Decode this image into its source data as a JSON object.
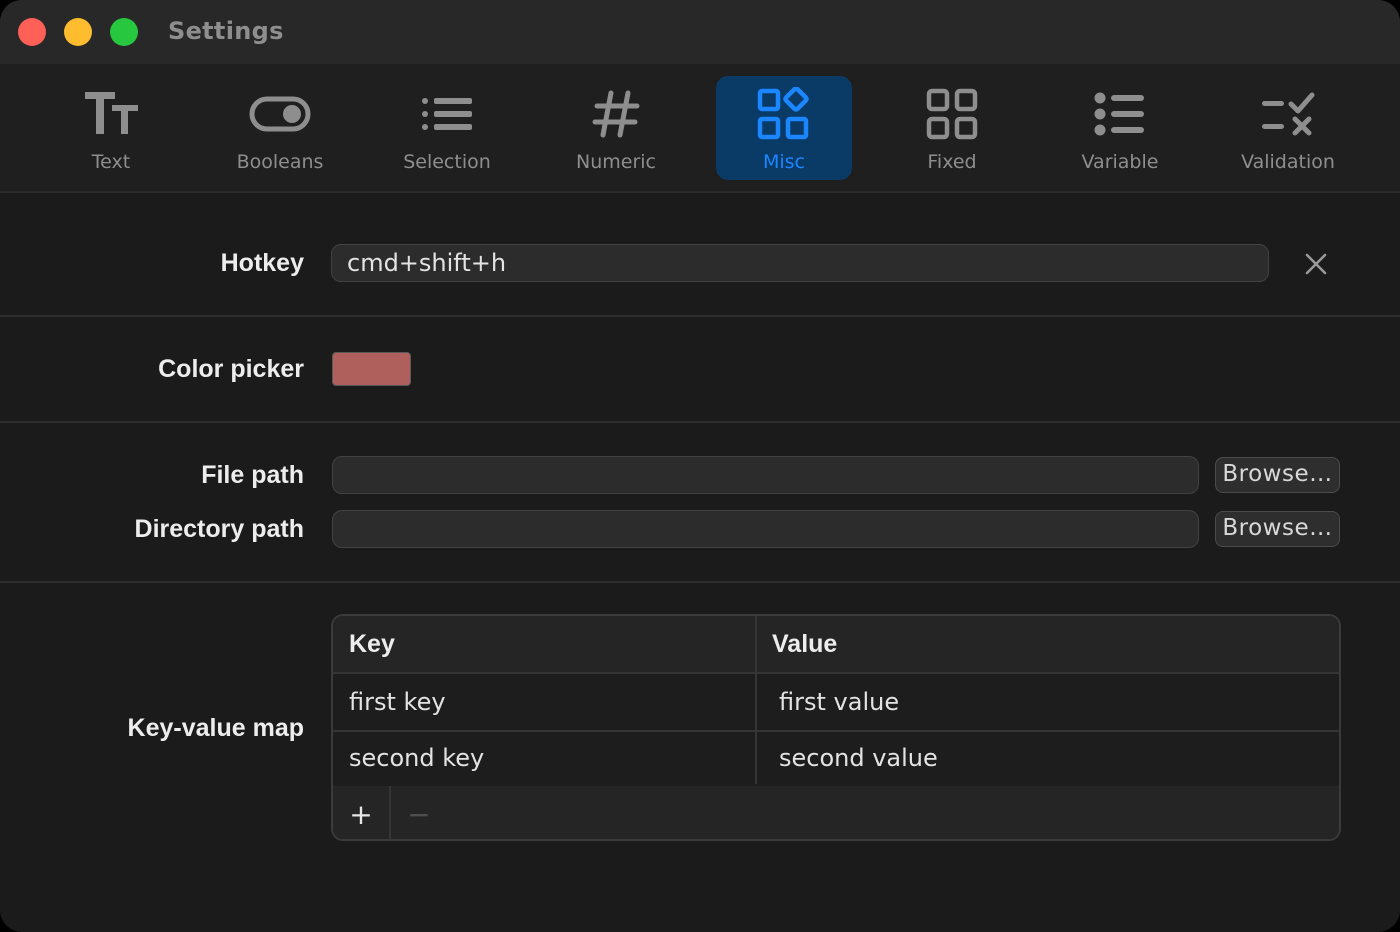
{
  "window": {
    "title": "Settings"
  },
  "toolbar": {
    "tabs": [
      {
        "label": "Text",
        "icon": "text-format-icon",
        "active": false
      },
      {
        "label": "Booleans",
        "icon": "toggle-icon",
        "active": false
      },
      {
        "label": "Selection",
        "icon": "list-icon",
        "active": false
      },
      {
        "label": "Numeric",
        "icon": "number-sign-icon",
        "active": false
      },
      {
        "label": "Misc",
        "icon": "apps-grid-icon",
        "active": true
      },
      {
        "label": "Fixed",
        "icon": "grid-icon",
        "active": false
      },
      {
        "label": "Variable",
        "icon": "bullet-list-icon",
        "active": false
      },
      {
        "label": "Validation",
        "icon": "checklist-icon",
        "active": false
      }
    ]
  },
  "hotkey": {
    "label": "Hotkey",
    "value": "cmd+shift+h"
  },
  "color_picker": {
    "label": "Color picker",
    "color": "#b0605c"
  },
  "file_path": {
    "label": "File path",
    "value": "",
    "browse_label": "Browse…"
  },
  "directory_path": {
    "label": "Directory path",
    "value": "",
    "browse_label": "Browse…"
  },
  "key_value_map": {
    "label": "Key-value map",
    "columns": [
      "Key",
      "Value"
    ],
    "rows": [
      {
        "key": "first key",
        "value": "first value"
      },
      {
        "key": "second key",
        "value": "second value"
      }
    ],
    "add_label": "+",
    "remove_label": "−"
  },
  "colors": {
    "accent": "#1b86ff",
    "active_tab_bg": "#0a3a66",
    "window_bg": "#1b1b1b",
    "close": "#fe5f57",
    "minimize": "#febc2e",
    "maximize": "#27c840"
  }
}
